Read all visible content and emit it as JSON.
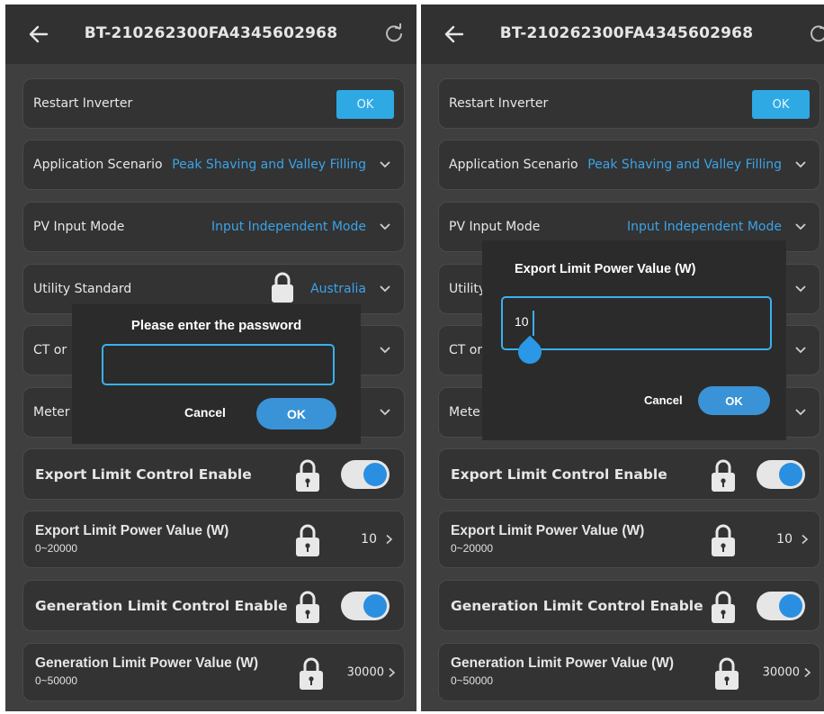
{
  "left": {
    "header": {
      "title": "BT-210262300FA4345602968"
    },
    "rows": {
      "restart": {
        "label": "Restart Inverter",
        "button": "OK"
      },
      "scenario": {
        "label": "Application Scenario",
        "value": "Peak Shaving and Valley Filling"
      },
      "pv": {
        "label": "PV Input Mode",
        "value": "Input Independent Mode"
      },
      "utility": {
        "label": "Utility Standard",
        "value": "Australia"
      },
      "ct": {
        "label": "CT or"
      },
      "meter": {
        "label": "Meter"
      },
      "export_enable": {
        "label": "Export Limit Control Enable"
      },
      "export_value": {
        "label": "Export Limit Power Value (W)",
        "range": "0~20000",
        "value": "10"
      },
      "gen_enable": {
        "label": "Generation Limit Control Enable"
      },
      "gen_value": {
        "label": "Generation Limit Power Value (W)",
        "range": "0~50000",
        "value": "30000"
      }
    },
    "dialog": {
      "title": "Please enter the password",
      "input_value": "",
      "cancel": "Cancel",
      "ok": "OK"
    }
  },
  "right": {
    "header": {
      "title": "BT-210262300FA4345602968"
    },
    "rows": {
      "restart": {
        "label": "Restart Inverter",
        "button": "OK"
      },
      "scenario": {
        "label": "Application Scenario",
        "value": "Peak Shaving and Valley Filling"
      },
      "pv": {
        "label": "PV Input Mode",
        "value": "Input Independent Mode"
      },
      "utility": {
        "label": "Utility"
      },
      "ct": {
        "label": "CT or"
      },
      "meter": {
        "label": "Mete"
      },
      "export_enable": {
        "label": "Export Limit Control Enable"
      },
      "export_value": {
        "label": "Export Limit Power Value (W)",
        "range": "0~20000",
        "value": "10"
      },
      "gen_enable": {
        "label": "Generation Limit Control Enable"
      },
      "gen_value": {
        "label": "Generation Limit Power Value (W)",
        "range": "0~50000",
        "value": "30000"
      }
    },
    "dialog": {
      "title": "Export Limit Power Value (W)",
      "input_value": "10",
      "cancel": "Cancel",
      "ok": "OK"
    }
  },
  "colors": {
    "accent": "#2ea9e4",
    "value_blue": "#3aa3e8",
    "background": "#3f3f3f",
    "card": "#333333"
  },
  "icons": [
    "back-arrow-icon",
    "refresh-icon",
    "chevron-down-icon",
    "chevron-right-icon",
    "lock-icon",
    "toggle-switch"
  ]
}
